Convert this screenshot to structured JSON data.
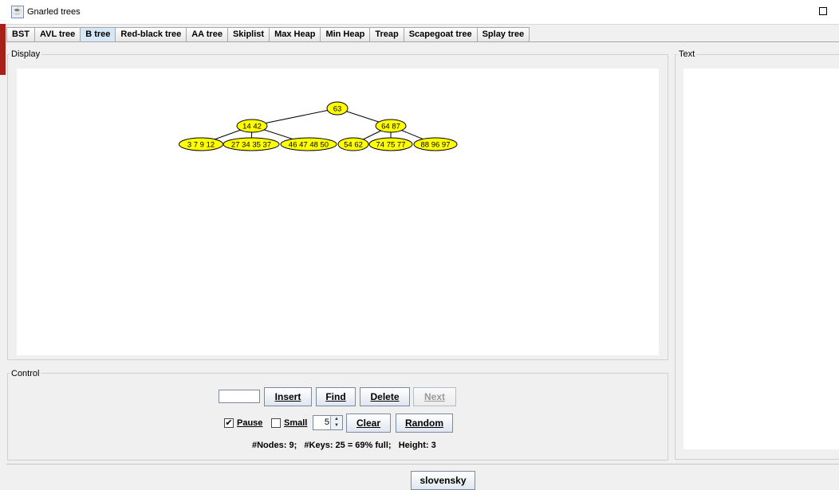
{
  "window": {
    "title": "Gnarled trees"
  },
  "tabs": [
    {
      "label": "BST",
      "active": false
    },
    {
      "label": "AVL tree",
      "active": false
    },
    {
      "label": "B tree",
      "active": true
    },
    {
      "label": "Red-black tree",
      "active": false
    },
    {
      "label": "AA tree",
      "active": false
    },
    {
      "label": "Skiplist",
      "active": false
    },
    {
      "label": "Max Heap",
      "active": false
    },
    {
      "label": "Min Heap",
      "active": false
    },
    {
      "label": "Treap",
      "active": false
    },
    {
      "label": "Scapegoat tree",
      "active": false
    },
    {
      "label": "Splay tree",
      "active": false
    }
  ],
  "panels": {
    "display": "Display",
    "text": "Text",
    "control": "Control"
  },
  "tree": {
    "node_color": "#ffff00",
    "root": {
      "keys": "63"
    },
    "level1": [
      {
        "keys": "14 42"
      },
      {
        "keys": "64 87"
      }
    ],
    "leaves": [
      {
        "keys": "3 7 9 12"
      },
      {
        "keys": "27 34 35 37"
      },
      {
        "keys": "46 47 48 50"
      },
      {
        "keys": "54 62"
      },
      {
        "keys": "74 75 77"
      },
      {
        "keys": "88 96 97"
      }
    ]
  },
  "controls": {
    "input_value": "",
    "insert": "Insert",
    "find": "Find",
    "delete": "Delete",
    "next": "Next",
    "pause": "Pause",
    "pause_checked": true,
    "small": "Small",
    "small_checked": false,
    "degree": "5",
    "clear": "Clear",
    "random": "Random"
  },
  "status": "#Nodes: 9;   #Keys: 25 = 69% full;   Height: 3",
  "language_button": "slovensky"
}
